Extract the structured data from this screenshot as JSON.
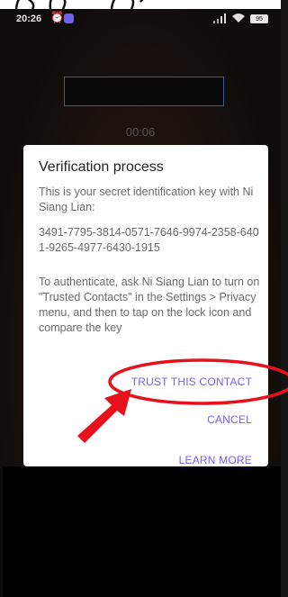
{
  "status_bar": {
    "time": "20:26",
    "alarm_icon": "alarm-clock-icon",
    "app_icon": "viber-icon",
    "battery": "95",
    "colors": {
      "viber": "#7360f2"
    }
  },
  "call": {
    "timer": "00:06"
  },
  "dialog": {
    "title": "Verification process",
    "intro": "This is your secret identification key with Ni Siang Lian:",
    "key": "3491-7795-3814-0571-7646-9974-2358-6401-9265-4977-6430-1915",
    "instructions": "To authenticate, ask Ni Siang Lian to turn on \"Trusted Contacts\" in the Settings > Privacy menu, and then to tap on the lock icon and compare the key",
    "buttons": {
      "trust": "TRUST THIS CONTACT",
      "cancel": "CANCEL",
      "learn_more": "LEARN MORE"
    },
    "accent_color": "#7360f2"
  },
  "annotations": {
    "highlight_color": "#e8101a"
  }
}
